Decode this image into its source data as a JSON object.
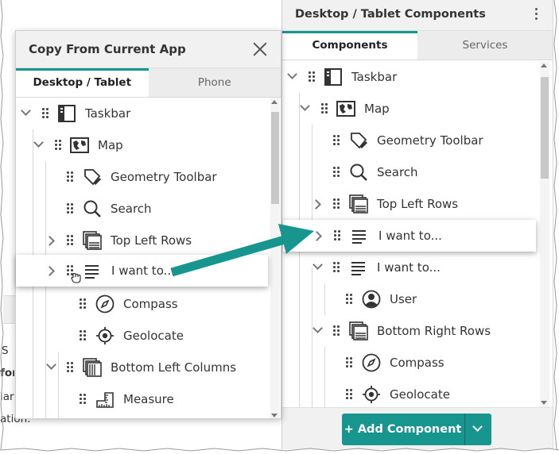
{
  "right_panel": {
    "title": "Desktop / Tablet Components",
    "tabs": [
      {
        "label": "Components",
        "active": true
      },
      {
        "label": "Services",
        "active": false
      }
    ],
    "tree": [
      {
        "label": "Taskbar",
        "icon": "taskbar-icon",
        "chevron": "down"
      },
      {
        "label": "Map",
        "icon": "map-icon",
        "chevron": "down"
      },
      {
        "label": "Geometry Toolbar",
        "icon": "geometry-toolbar-icon"
      },
      {
        "label": "Search",
        "icon": "search-icon"
      },
      {
        "label": "Top Left Rows",
        "icon": "rows-icon",
        "chevron": "right"
      },
      {
        "label": "I want to...",
        "icon": "list-icon",
        "chevron": "down"
      },
      {
        "label": "User",
        "icon": "user-icon"
      },
      {
        "label": "Bottom Right Rows",
        "icon": "rows-icon",
        "chevron": "down"
      },
      {
        "label": "Compass",
        "icon": "compass-icon"
      },
      {
        "label": "Geolocate",
        "icon": "geolocate-icon"
      }
    ],
    "add_button": "+ Add Component",
    "drop_item": {
      "label": "I want to...",
      "icon": "list-icon"
    }
  },
  "left_dialog": {
    "title": "Copy From Current App",
    "tabs": [
      {
        "label": "Desktop / Tablet",
        "active": true
      },
      {
        "label": "Phone",
        "active": false
      }
    ],
    "tree": [
      {
        "label": "Taskbar",
        "icon": "taskbar-icon",
        "chevron": "down"
      },
      {
        "label": "Map",
        "icon": "map-icon",
        "chevron": "down"
      },
      {
        "label": "Geometry Toolbar",
        "icon": "geometry-toolbar-icon"
      },
      {
        "label": "Search",
        "icon": "search-icon"
      },
      {
        "label": "Top Left Rows",
        "icon": "rows-icon",
        "chevron": "right"
      },
      {
        "label": "Compass",
        "icon": "compass-icon"
      },
      {
        "label": "Geolocate",
        "icon": "geolocate-icon"
      },
      {
        "label": "Bottom Left Columns",
        "icon": "columns-icon",
        "chevron": "down"
      },
      {
        "label": "Measure",
        "icon": "measure-icon"
      }
    ],
    "drag_item": {
      "label": "I want to...",
      "icon": "list-icon",
      "chevron": "right"
    }
  },
  "background": {
    "fragments": [
      "S",
      "for",
      "lar",
      "ation."
    ]
  },
  "colors": {
    "accent": "#17958f",
    "arrow": "#17958f"
  }
}
